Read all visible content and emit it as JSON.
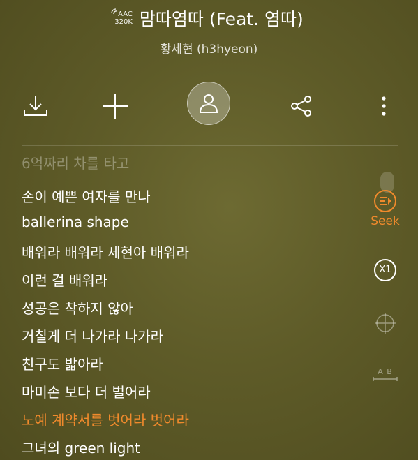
{
  "track": {
    "quality_codec": "AAC",
    "quality_bitrate": "320K",
    "title": "맘따염따 (Feat. 염따)",
    "artist": "황세현 (h3hyeon)"
  },
  "toolbar": {
    "download_icon": "download-icon",
    "add_icon": "plus-icon",
    "artist_icon": "person-icon",
    "share_icon": "share-icon",
    "more_icon": "more-vertical-icon"
  },
  "lyrics": [
    "6억짜리 차를 타고",
    "손이 예쁜 여자를 만나",
    "ballerina shape",
    "배워라 배워라 세현아 배워라",
    "이런 걸 배워라",
    "성공은 착하지 않아",
    "거칠게 더 나가라 나가라",
    "친구도 밟아라",
    "마미손 보다 더 벌어라",
    "노예 계약서를 벗어라 벗어라",
    "그녀의 green light"
  ],
  "active_lyric_index": 9,
  "side": {
    "seek_label": "Seek",
    "speed_label": "X1",
    "ab_label": "A B"
  },
  "colors": {
    "accent": "#f08a2c",
    "background": "#5e5b28"
  }
}
